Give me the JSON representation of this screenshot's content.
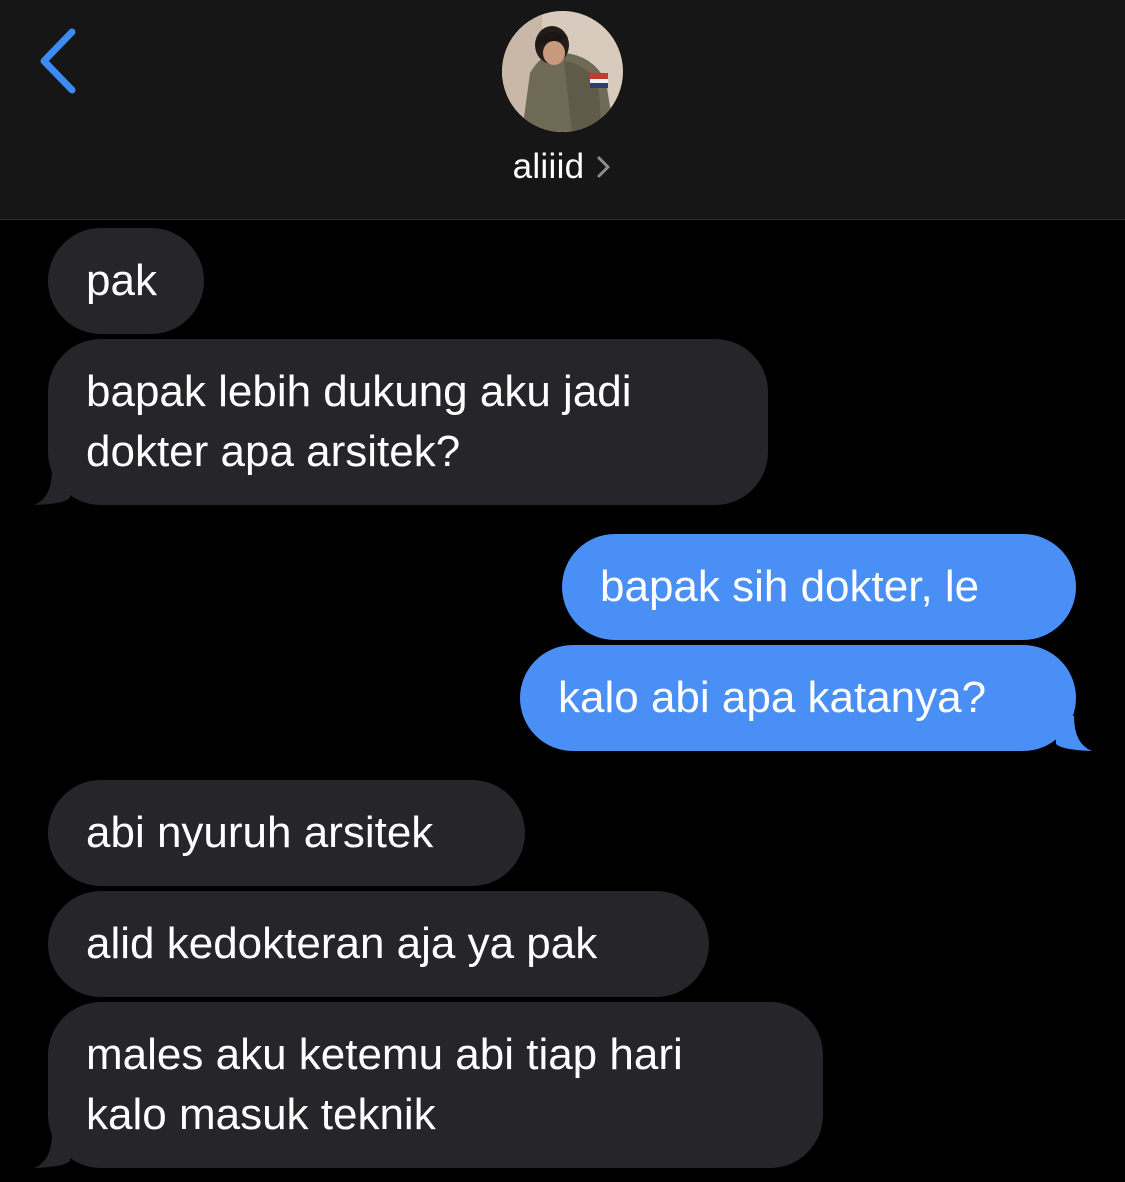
{
  "header": {
    "contact_name": "aliiid"
  },
  "icons": {
    "back": "chevron-left-icon",
    "contact_detail": "chevron-right-icon"
  },
  "colors": {
    "accent": "#3b8cf5",
    "incoming_bubble": "#26252a",
    "outgoing_bubble": "#4a8ff5",
    "background": "#000000",
    "header_bg": "#161616"
  },
  "messages": [
    {
      "direction": "incoming",
      "lines": [
        "pak"
      ]
    },
    {
      "direction": "incoming",
      "lines": [
        "bapak lebih dukung aku jadi",
        "dokter apa arsitek?"
      ]
    },
    {
      "direction": "outgoing",
      "lines": [
        "bapak sih dokter, le"
      ]
    },
    {
      "direction": "outgoing",
      "lines": [
        "kalo abi apa katanya?"
      ]
    },
    {
      "direction": "incoming",
      "lines": [
        "abi nyuruh arsitek"
      ]
    },
    {
      "direction": "incoming",
      "lines": [
        "alid kedokteran aja ya pak"
      ]
    },
    {
      "direction": "incoming",
      "lines": [
        "males aku ketemu abi tiap hari",
        "kalo masuk teknik"
      ]
    }
  ]
}
